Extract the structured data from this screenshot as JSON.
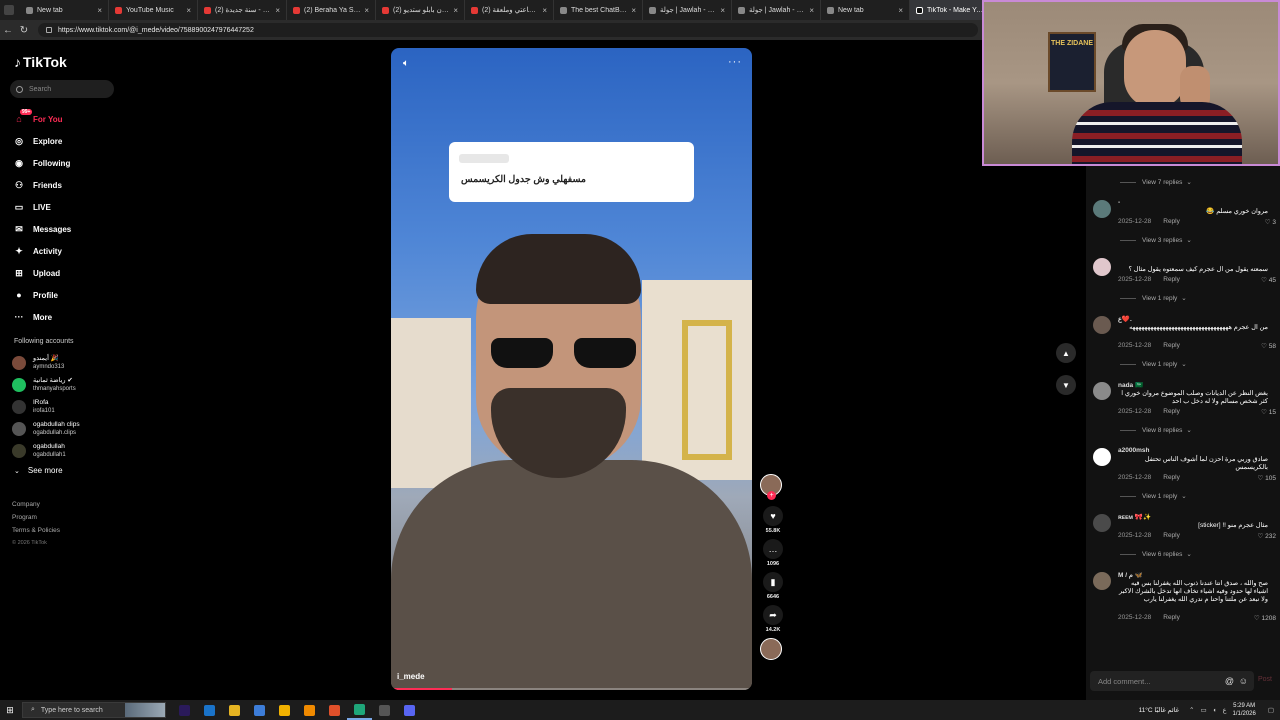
{
  "browser": {
    "tabs": [
      {
        "title": "New tab",
        "fav": "plain"
      },
      {
        "title": "YouTube Music",
        "fav": "red"
      },
      {
        "title": "(2) سنة جديدة - YouTube",
        "fav": "red"
      },
      {
        "title": "(2) Beraha Ya Sheekha",
        "fav": "red"
      },
      {
        "title": "(2) مروان بابلو ستديو...",
        "fav": "red"
      },
      {
        "title": "(2) ولدت ساعتي وملعقة",
        "fav": "red"
      },
      {
        "title": "The best ChatBot and",
        "fav": "plain"
      },
      {
        "title": "جولة | Jawlah - منصة",
        "fav": "plain"
      },
      {
        "title": "جولة | Jawlah - منصة",
        "fav": "plain"
      },
      {
        "title": "New tab",
        "fav": "plain"
      },
      {
        "title": "TikTok - Make Your",
        "fav": "tt",
        "active": true
      }
    ],
    "url": "https://www.tiktok.com/@i_mede/video/7588900247976447252"
  },
  "sidebar": {
    "brand": "TikTok",
    "search_placeholder": "Search",
    "menu": [
      {
        "label": "For You",
        "icon": "home-icon",
        "glyph": "⌂",
        "active": true
      },
      {
        "label": "Explore",
        "icon": "compass-icon",
        "glyph": "◎"
      },
      {
        "label": "Following",
        "icon": "following-icon",
        "glyph": "◉"
      },
      {
        "label": "Friends",
        "icon": "friends-icon",
        "glyph": "⚇"
      },
      {
        "label": "LIVE",
        "icon": "live-icon",
        "glyph": "▭"
      },
      {
        "label": "Messages",
        "icon": "messages-icon",
        "glyph": "✉",
        "badge": "99+"
      },
      {
        "label": "Activity",
        "icon": "activity-icon",
        "glyph": "✦",
        "badge": "99+"
      },
      {
        "label": "Upload",
        "icon": "upload-icon",
        "glyph": "⊞"
      },
      {
        "label": "Profile",
        "icon": "profile-icon",
        "glyph": "●"
      },
      {
        "label": "More",
        "icon": "more-icon",
        "glyph": "···"
      }
    ],
    "following_title": "Following accounts",
    "following": [
      {
        "name": "أيمندو 🎉",
        "handle": "aymndo313",
        "color": "#7a4a3a"
      },
      {
        "name": "رياضة ثمانية ✔",
        "handle": "thmanyahsports",
        "color": "#1fbf5f"
      },
      {
        "name": "IRofa",
        "handle": "irofa101",
        "color": "#333333"
      },
      {
        "name": "ogabdullah clips",
        "handle": "ogabdullah.clips",
        "color": "#555555"
      },
      {
        "name": "ogabdullah",
        "handle": "ogabdullah1",
        "color": "#3a3a2a"
      }
    ],
    "see_more": "See more",
    "footer": {
      "company": "Company",
      "program": "Program",
      "terms": "Terms & Policies",
      "copyright": "© 2026 TikTok"
    }
  },
  "video": {
    "question": "مسفهلي وش جدول الكريسمس",
    "username": "i_mede",
    "progress": 0.17
  },
  "actions": {
    "likes": "55.8K",
    "comments": "1096",
    "saves": "6646",
    "shares": "14.2K"
  },
  "comments": [
    {
      "type": "replies",
      "label": "View 7 replies"
    },
    {
      "type": "comment",
      "user": "-",
      "text": "مروان خوري مسلم 😂",
      "date": "2025-12-28",
      "reply": "Reply",
      "likes": "3",
      "avatar": "#5b7a7a"
    },
    {
      "type": "replies",
      "label": "View 3 replies"
    },
    {
      "type": "comment",
      "user": "",
      "text": "سمعته يقول من ال عجرم كيف سمعتوه يقول مثال ؟",
      "date": "2025-12-28",
      "reply": "Reply",
      "likes": "45",
      "avatar": "#e0c7cc"
    },
    {
      "type": "replies",
      "label": "View 1 reply"
    },
    {
      "type": "comment",
      "user": "ع❤️.",
      "text": "من ال عجرم هههههههههههههههههههههههههههههههههه",
      "date": "2025-12-28",
      "reply": "Reply",
      "likes": "58",
      "avatar": "#6a5a50"
    },
    {
      "type": "replies",
      "label": "View 1 reply"
    },
    {
      "type": "comment",
      "user": "nada 🇸🇦",
      "text": "بغض النظر عن الديانات وصلب الموضوع مروان خوري ا كثر شخص مسالم ولا له دخل ب احد",
      "date": "2025-12-28",
      "reply": "Reply",
      "likes": "15",
      "avatar": "#8a8a8a"
    },
    {
      "type": "replies",
      "label": "View 8 replies"
    },
    {
      "type": "comment",
      "user": "a2000msh",
      "text": "صادق وربي مرة احزن لما أشوف الناس تحتفل بالكريسمس",
      "date": "2025-12-28",
      "reply": "Reply",
      "likes": "105",
      "avatar": "#ffffff"
    },
    {
      "type": "replies",
      "label": "View 1 reply"
    },
    {
      "type": "comment",
      "user": "ʀᴇᴇᴍ 🎀✨",
      "text": "مثال عجرم منو !! [sticker]",
      "date": "2025-12-28",
      "reply": "Reply",
      "likes": "232",
      "avatar": "#4a4a4a"
    },
    {
      "type": "replies",
      "label": "View 6 replies"
    },
    {
      "type": "comment",
      "user": "M / م 🦋",
      "text": "صح والله ، صدق انتا عندنا ذنوب الله يغفرلنا بس فيه اشياء لها حدود وفيه اشياء تخاف انها تدخل بالشرك الاكبر ولا نبعد عن ملتنا واحنا م ندري الله يغفرلنا يارب",
      "date": "2025-12-28",
      "reply": "Reply",
      "likes": "1208",
      "avatar": "#7a6a5a"
    }
  ],
  "add_comment_placeholder": "Add comment...",
  "post_label": "Post",
  "webcam": {
    "poster_text": "THE ZIDANE"
  },
  "taskbar": {
    "search_placeholder": "Type here to search",
    "apps": [
      {
        "name": "premiere-app",
        "color": "#2a1a5a"
      },
      {
        "name": "app-blue",
        "color": "#1a73c9"
      },
      {
        "name": "file-explorer-app",
        "color": "#e6b422"
      },
      {
        "name": "notepad-app",
        "color": "#3d7dd8"
      },
      {
        "name": "chrome-app",
        "color": "#f2b200"
      },
      {
        "name": "vlc-app",
        "color": "#f08a00"
      },
      {
        "name": "brave-app",
        "color": "#e0502a"
      },
      {
        "name": "edge-app",
        "color": "#1fa67a",
        "on": true
      },
      {
        "name": "obs-app",
        "color": "#555555"
      },
      {
        "name": "discord-app",
        "color": "#5865f2"
      }
    ],
    "weather": "11°C غائم غالبًا",
    "lang": "ع",
    "time": "5:29 AM",
    "date": "1/1/2026"
  }
}
